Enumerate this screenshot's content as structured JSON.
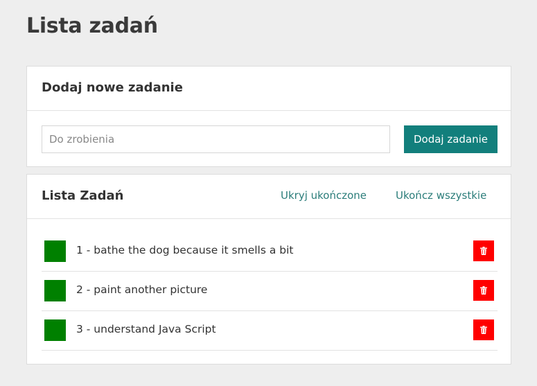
{
  "page": {
    "title": "Lista zadań"
  },
  "add_card": {
    "title": "Dodaj nowe zadanie",
    "input_placeholder": "Do zrobienia",
    "input_value": "",
    "button_label": "Dodaj zadanie"
  },
  "list_card": {
    "title": "Lista Zadań",
    "hide_completed_label": "Ukryj ukończone",
    "complete_all_label": "Ukończ wszystkie",
    "tasks": [
      {
        "text": "1 - bathe the dog because it smells a bit"
      },
      {
        "text": "2 - paint another picture"
      },
      {
        "text": "3 - understand Java Script"
      }
    ]
  },
  "icons": {
    "delete": "trash-icon"
  },
  "colors": {
    "accent": "#127f7c",
    "link": "#2b7d7a",
    "task_marker": "#008000",
    "delete": "#ff0000",
    "background": "#eeeeee"
  }
}
